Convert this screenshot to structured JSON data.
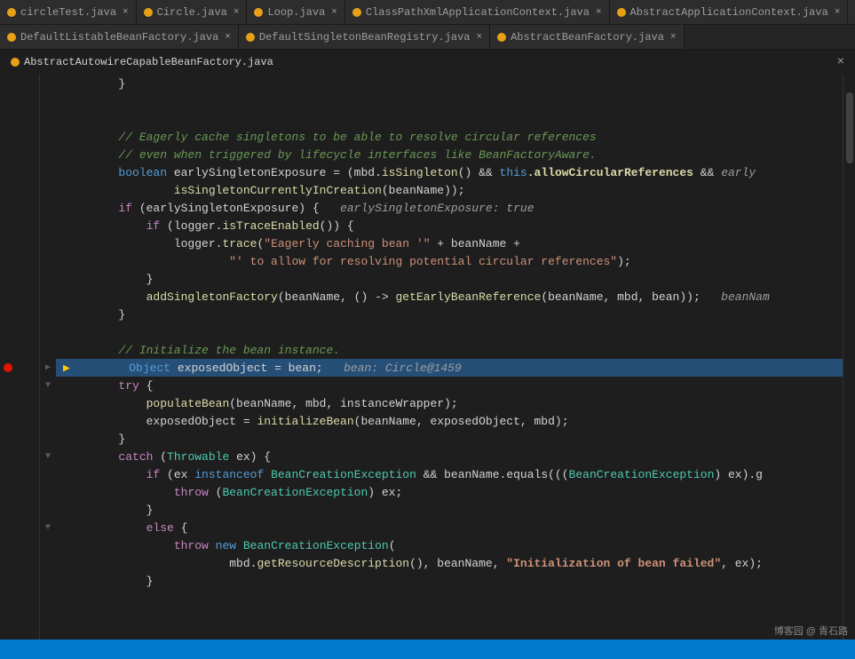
{
  "tabs_row1": [
    {
      "label": "circleTest.java",
      "active": false,
      "closable": true
    },
    {
      "label": "Circle.java",
      "active": false,
      "closable": true
    },
    {
      "label": "Loop.java",
      "active": false,
      "closable": true
    },
    {
      "label": "ClassPathXmlApplicationContext.java",
      "active": false,
      "closable": true
    },
    {
      "label": "AbstractApplicationContext.java",
      "active": false,
      "closable": true
    }
  ],
  "tabs_row2": [
    {
      "label": "DefaultListableBeanFactory.java",
      "active": false,
      "closable": true
    },
    {
      "label": "DefaultSingletonBeanRegistry.java",
      "active": false,
      "closable": true
    },
    {
      "label": "AbstractBeanFactory.java",
      "active": false,
      "closable": true
    }
  ],
  "current_file": "AbstractAutowireCapableBeanFactory.java",
  "lines": [
    {
      "num": "",
      "code": "plain",
      "text": "        }"
    },
    {
      "num": "",
      "code": "plain",
      "text": ""
    },
    {
      "num": "",
      "code": "plain",
      "text": ""
    },
    {
      "num": "",
      "code": "comment",
      "text": "        // Eagerly cache singletons to be able to resolve circular references"
    },
    {
      "num": "",
      "code": "comment",
      "text": "        // even when triggered by lifecycle interfaces like BeanFactoryAware."
    },
    {
      "num": "",
      "code": "mixed",
      "text": "        boolean earlySingletonExposure = (mbd.isSingleton() && this.allowCircularReferences && early"
    },
    {
      "num": "",
      "code": "plain",
      "text": "                isSingletonCurrentlyInCreation(beanName));"
    },
    {
      "num": "",
      "code": "mixed",
      "text": "        if (earlySingletonExposure) {   earlySingletonExposure: true"
    },
    {
      "num": "",
      "code": "plain",
      "text": "            if (logger.isTraceEnabled()) {"
    },
    {
      "num": "",
      "code": "str",
      "text": "                logger.trace(\"Eagerly caching bean '\" + beanName +"
    },
    {
      "num": "",
      "code": "str",
      "text": "                        \"' to allow for resolving potential circular references\");"
    },
    {
      "num": "",
      "code": "plain",
      "text": "            }"
    },
    {
      "num": "",
      "code": "plain",
      "text": "            addSingletonFactory(beanName, () -> getEarlyBeanReference(beanName, mbd, bean));   beanNam"
    },
    {
      "num": "",
      "code": "plain",
      "text": "        }"
    },
    {
      "num": "",
      "code": "plain",
      "text": ""
    },
    {
      "num": "",
      "code": "comment",
      "text": "        // Initialize the bean instance."
    },
    {
      "num": "",
      "code": "highlight",
      "text": "        Object exposedObject = bean;   bean: Circle@1459"
    },
    {
      "num": "",
      "code": "try",
      "text": "        try {"
    },
    {
      "num": "",
      "code": "plain",
      "text": "            populateBean(beanName, mbd, instanceWrapper);"
    },
    {
      "num": "",
      "code": "plain",
      "text": "            exposedObject = initializeBean(beanName, exposedObject, mbd);"
    },
    {
      "num": "",
      "code": "plain",
      "text": "        }"
    },
    {
      "num": "",
      "code": "catch",
      "text": "        catch (Throwable ex) {"
    },
    {
      "num": "",
      "code": "plain",
      "text": "            if (ex instanceof BeanCreationException && beanName.equals(((BeanCreationException) ex).g"
    },
    {
      "num": "",
      "code": "throw",
      "text": "                throw (BeanCreationException) ex;"
    },
    {
      "num": "",
      "code": "plain",
      "text": "            }"
    },
    {
      "num": "",
      "code": "else",
      "text": "            else {"
    },
    {
      "num": "",
      "code": "throw2",
      "text": "                throw new BeanCreationException("
    },
    {
      "num": "",
      "code": "plain",
      "text": "                        mbd.getResourceDescription(), beanName, \"Initialization of bean failed\", ex);"
    },
    {
      "num": "",
      "code": "plain",
      "text": "            }"
    }
  ],
  "watermark": "博客园 @ 青石路",
  "bottom_bar": ""
}
